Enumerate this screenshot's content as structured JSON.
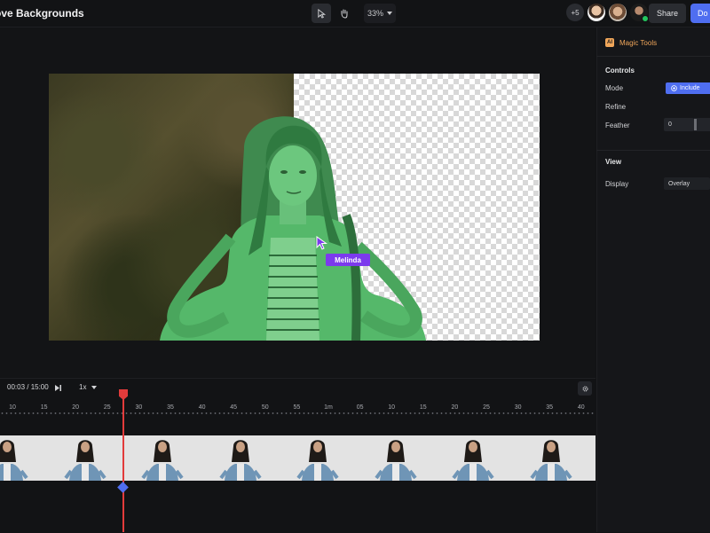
{
  "app": {
    "title": "ove Backgrounds"
  },
  "toolbar": {
    "tools": [
      {
        "icon": "pointer-icon"
      },
      {
        "icon": "hand-icon"
      }
    ],
    "zoom": "33%"
  },
  "collaborators": {
    "extra_count": "+5"
  },
  "header_actions": {
    "share_label": "Share",
    "done_label": "Do"
  },
  "canvas": {
    "cursor_user": "Melinda",
    "cursor_color": "#7c3aed",
    "mask_color": "#55b86a"
  },
  "panel": {
    "magic_badge": "AI",
    "magic_label": "Magic Tools",
    "controls_heading": "Controls",
    "mode_label": "Mode",
    "mode_value": "Include",
    "refine_label": "Refine",
    "feather_label": "Feather",
    "feather_value": "0",
    "view_heading": "View",
    "display_label": "Display",
    "display_value": "Overlay"
  },
  "timeline": {
    "time": "00:03 / 15:00",
    "speed": "1x",
    "ruler": [
      "10",
      "15",
      "20",
      "25",
      "30",
      "35",
      "40",
      "45",
      "50",
      "55",
      "1m",
      "05",
      "10",
      "15",
      "20",
      "25",
      "30",
      "35",
      "40"
    ],
    "playhead_color": "#e23b3b",
    "keyframe_color": "#4f6ef0"
  },
  "colors": {
    "accent": "#4f6ef0",
    "magic": "#f0a65a",
    "background": "#111214"
  }
}
